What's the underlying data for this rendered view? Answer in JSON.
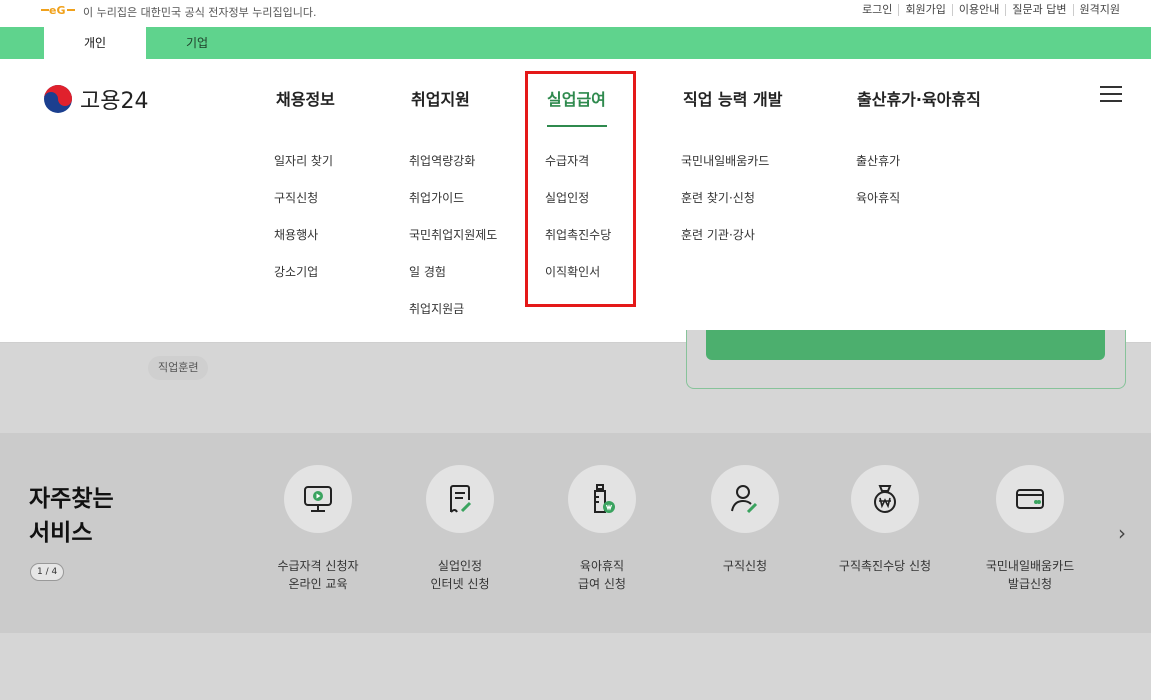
{
  "notice_bar": {
    "notice_text": "이 누리집은 대한민국 공식 전자정부 누리집입니다.",
    "util_links": [
      "로그인",
      "회원가입",
      "이용안내",
      "질문과 답변",
      "원격지원"
    ]
  },
  "tabs": [
    {
      "label": "개인",
      "active": true
    },
    {
      "label": "기업",
      "active": false
    }
  ],
  "header": {
    "logo_text": "고용24",
    "nav": [
      {
        "label": "채용정보",
        "active": false
      },
      {
        "label": "취업지원",
        "active": false
      },
      {
        "label": "실업급여",
        "active": true
      },
      {
        "label": "직업 능력 개발",
        "active": false
      },
      {
        "label": "출산휴가·육아휴직",
        "active": false
      }
    ]
  },
  "mega_menu": {
    "columns": [
      [
        "일자리 찾기",
        "구직신청",
        "채용행사",
        "강소기업"
      ],
      [
        "취업역량강화",
        "취업가이드",
        "국민취업지원제도",
        "일 경험",
        "취업지원금"
      ],
      [
        "수급자격",
        "실업인정",
        "취업촉진수당",
        "이직확인서"
      ],
      [
        "국민내일배움카드",
        "훈련 찾기·신청",
        "훈련 기관·강사"
      ],
      [
        "출산휴가",
        "육아휴직"
      ]
    ]
  },
  "background": {
    "chip_label": "직업훈련"
  },
  "services": {
    "title_line1": "자주찾는",
    "title_line2": "서비스",
    "pager": "1 / 4",
    "items": [
      {
        "label": "수급자격 신청자\n온라인 교육",
        "icon": "monitor-play-icon"
      },
      {
        "label": "실업인정\n인터넷 신청",
        "icon": "document-edit-icon"
      },
      {
        "label": "육아휴직\n급여 신청",
        "icon": "baby-bottle-icon"
      },
      {
        "label": "구직신청",
        "icon": "user-edit-icon"
      },
      {
        "label": "구직촉진수당 신청",
        "icon": "money-bag-icon"
      },
      {
        "label": "국민내일배움카드\n발급신청",
        "icon": "card-icon"
      }
    ]
  },
  "colors": {
    "brand_green": "#5fd38d",
    "active_green": "#2f8a4e",
    "highlight_red": "#e41818"
  }
}
